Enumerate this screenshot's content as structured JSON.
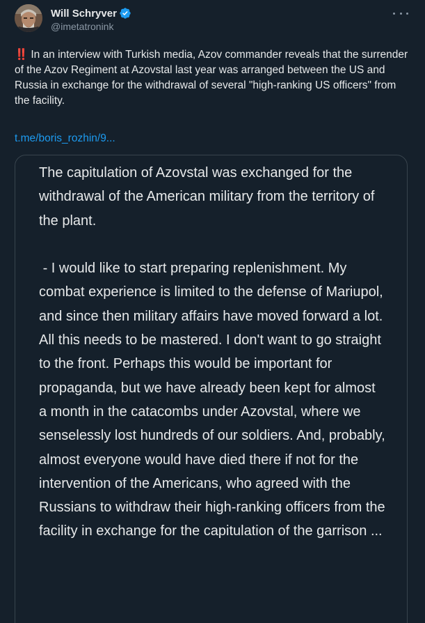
{
  "author": {
    "display_name": "Will Schryver",
    "handle": "@imetatronink",
    "verified": true,
    "avatar_icon": "user-photo-avatar",
    "verified_color": "#1d9bf0"
  },
  "menu": {
    "more_icon": "ellipsis-icon"
  },
  "tweet": {
    "alert_emoji": "‼️",
    "text": "In an interview with Turkish media, Azov commander reveals that the surrender of the Azov Regiment at Azovstal last year was arranged between the US and Russia in exchange for the withdrawal of several \"high-ranking US officers\" from the facility.",
    "link_text": "t.me/boris_rozhin/9...",
    "link_color": "#1d9bf0"
  },
  "media": {
    "paragraph_1": "The capitulation of Azovstal was exchanged for the withdrawal of the American military from the territory of the plant.",
    "paragraph_2": " - I would like to start preparing replenishment. My combat experience is limited to the defense of Mariupol, and since then military affairs have moved forward a lot. All this needs to be mastered. I don't want to go straight to the front. Perhaps this would be important for propaganda, but we have already been kept for almost a month in the catacombs under Azovstal, where we senselessly lost hundreds of our soldiers. And, probably, almost everyone would have died there if not for the intervention of the Americans, who agreed with the Russians to withdraw their high-ranking officers from the facility in exchange for the capitulation of the garrison ..."
  },
  "colors": {
    "background": "#15202b",
    "text": "#e7e9ea",
    "secondary_text": "#8b98a5",
    "border": "#38444d"
  }
}
